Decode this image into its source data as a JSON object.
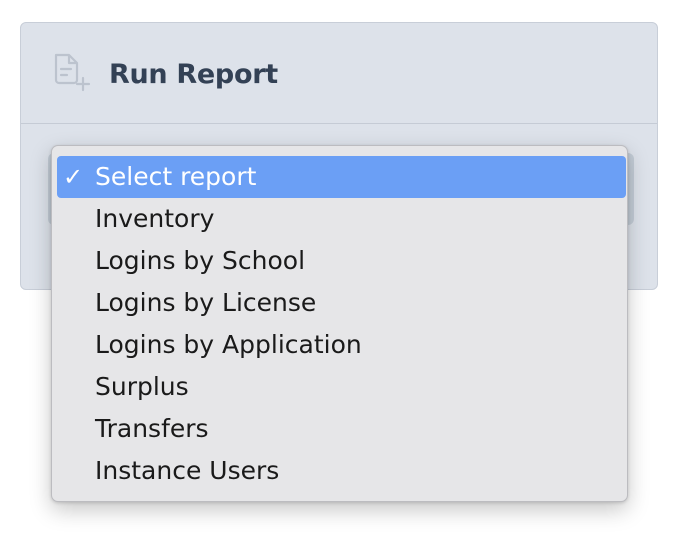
{
  "card": {
    "title": "Run Report",
    "icon": "document-add-icon"
  },
  "report_select": {
    "check_glyph": "✓",
    "selected_index": 0,
    "options": [
      "Select report",
      "Inventory",
      "Logins by School",
      "Logins by License",
      "Logins by Application",
      "Surplus",
      "Transfers",
      "Instance Users"
    ]
  },
  "colors": {
    "highlight": "#6b9ff5",
    "card_background": "#dde2ea",
    "title_text": "#334155"
  }
}
